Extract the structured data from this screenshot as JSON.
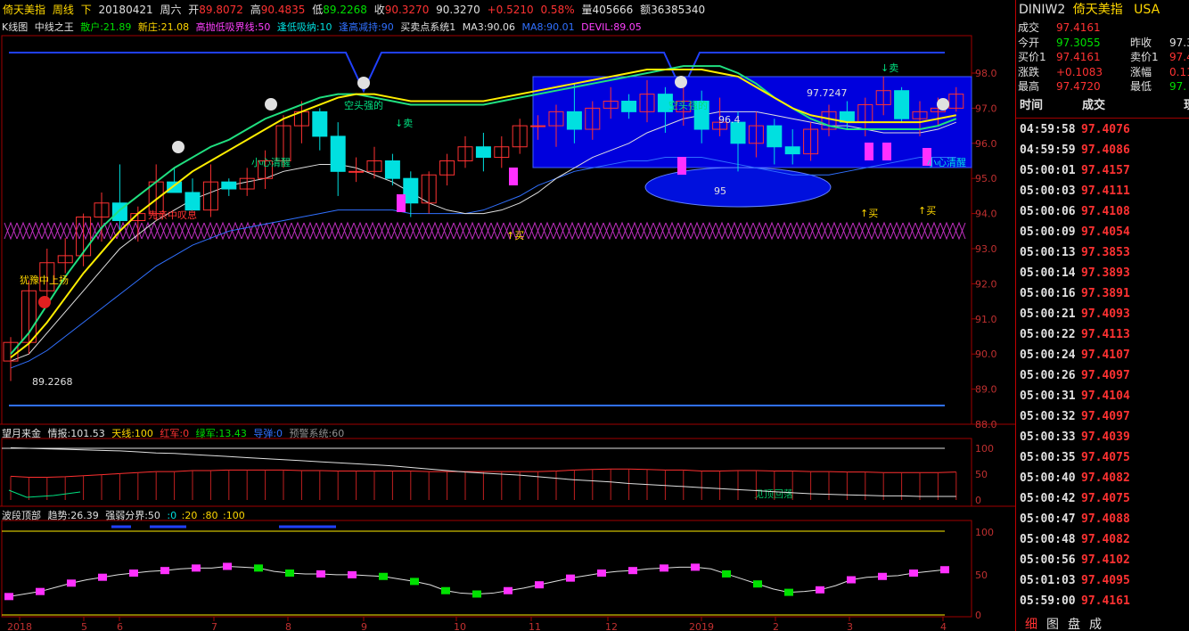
{
  "topbar": {
    "name": "倚天美指",
    "period": "周线",
    "direction": "下",
    "date": "20180421",
    "weekday": "周六",
    "open_label": "开",
    "open": "89.8072",
    "high_label": "高",
    "high": "90.4835",
    "low_label": "低",
    "low": "89.2268",
    "close_label": "收",
    "close": "90.3270",
    "close2": "90.3270",
    "change": "+0.5210",
    "change_pct": "0.58%",
    "volume_label": "量",
    "volume": "405666",
    "amount_label": "额",
    "amount": "36385340"
  },
  "main_legend": {
    "chart_kind": "K线图",
    "indicator": "中线之王",
    "sanhu": "散户:21.89",
    "xinzhuang": "新庄:21.08",
    "gaopao": "高抛低吸界线:50",
    "fengdi": "逢低吸纳:10",
    "fenggao": "逢高减持:90",
    "maimai": "买卖点系统1",
    "ma3": "MA3:90.06",
    "ma8": "MA8:90.01",
    "devil": "DEVIL:89.05"
  },
  "sub1_legend": {
    "name": "望月来金",
    "qingbao": "情报:101.53",
    "tianxian": "天线:100",
    "hongjun": "红军:0",
    "lvjun": "绿军:13.43",
    "dijiang": "导弹:0",
    "yujing": "预警系统:60"
  },
  "sub2_legend": {
    "name": "波段顶部",
    "qushi": "趋势:26.39",
    "qiangruo": "强弱分界:50",
    "l0": ":0",
    "l20": ":20",
    "l80": ":80",
    "l100": ":100"
  },
  "main_axis": [
    "98.0",
    "97.0",
    "96.0",
    "95.0",
    "94.0",
    "93.0",
    "92.0",
    "91.0",
    "90.0",
    "89.0",
    "88.0"
  ],
  "sub1_axis": [
    "100",
    "50",
    "0"
  ],
  "sub2_axis": [
    "100",
    "50",
    "0"
  ],
  "x_axis": [
    "2018",
    "5",
    "6",
    "7",
    "8",
    "9",
    "10",
    "11",
    "12",
    "2019",
    "2",
    "3",
    "4"
  ],
  "annotations": {
    "start_price": "89.2268",
    "price_97": "97.7247",
    "price_964": "96.4",
    "price_95": "95",
    "youyu": "犹豫中上扬",
    "xiaoxin1": "小心清醒",
    "xiaoxin2": "小心清醒",
    "kongtou1": "空头强的",
    "kongtou2": "空头强的",
    "xianxian": "先亲中叹息",
    "jiandui": "见顶回落",
    "sell1": "↓卖",
    "sell2": "↓卖",
    "buy1": "↑买",
    "buy2": "↑买",
    "buy3": "↑买"
  },
  "sidebar": {
    "symbol": "DINIW2",
    "name": "倚天美指",
    "market": "USA",
    "quote": [
      {
        "l1": "成交",
        "v1": "97.4161",
        "c1": "red",
        "l2": "",
        "v2": "",
        "c2": ""
      },
      {
        "l1": "今开",
        "v1": "97.3055",
        "c1": "grn",
        "l2": "昨收",
        "v2": "97.3",
        "c2": "wht"
      },
      {
        "l1": "买价1",
        "v1": "97.4161",
        "c1": "red",
        "l2": "卖价1",
        "v2": "97.4",
        "c2": "red"
      },
      {
        "l1": "涨跌",
        "v1": "+0.1083",
        "c1": "red",
        "l2": "涨幅",
        "v2": "0.11",
        "c2": "red"
      },
      {
        "l1": "最高",
        "v1": "97.4720",
        "c1": "red",
        "l2": "最低",
        "v2": "97.",
        "c2": "grn"
      }
    ],
    "ticks_header": {
      "time": "时间",
      "price": "成交",
      "extra": "现"
    },
    "ticks": [
      {
        "time": "04:59:58",
        "price": "97.4076"
      },
      {
        "time": "04:59:59",
        "price": "97.4086"
      },
      {
        "time": "05:00:01",
        "price": "97.4157"
      },
      {
        "time": "05:00:03",
        "price": "97.4111"
      },
      {
        "time": "05:00:06",
        "price": "97.4108"
      },
      {
        "time": "05:00:09",
        "price": "97.4054"
      },
      {
        "time": "05:00:13",
        "price": "97.3853"
      },
      {
        "time": "05:00:14",
        "price": "97.3893"
      },
      {
        "time": "05:00:16",
        "price": "97.3891"
      },
      {
        "time": "05:00:21",
        "price": "97.4093"
      },
      {
        "time": "05:00:22",
        "price": "97.4113"
      },
      {
        "time": "05:00:24",
        "price": "97.4107"
      },
      {
        "time": "05:00:26",
        "price": "97.4097"
      },
      {
        "time": "05:00:31",
        "price": "97.4104"
      },
      {
        "time": "05:00:32",
        "price": "97.4097"
      },
      {
        "time": "05:00:33",
        "price": "97.4039"
      },
      {
        "time": "05:00:35",
        "price": "97.4075"
      },
      {
        "time": "05:00:40",
        "price": "97.4082"
      },
      {
        "time": "05:00:42",
        "price": "97.4075"
      },
      {
        "time": "05:00:47",
        "price": "97.4088"
      },
      {
        "time": "05:00:48",
        "price": "97.4082"
      },
      {
        "time": "05:00:56",
        "price": "97.4102"
      },
      {
        "time": "05:01:03",
        "price": "97.4095"
      },
      {
        "time": "05:59:00",
        "price": "97.4161"
      }
    ],
    "tabs": [
      "细",
      "图",
      "盘",
      "成"
    ]
  },
  "colors": {
    "up": "#ff3232",
    "down": "#00e0e0",
    "grid": "#800000",
    "accent": "#ffd700"
  },
  "chart_data": {
    "type": "candlestick",
    "candles": [
      {
        "o": 89.8,
        "h": 90.48,
        "l": 89.23,
        "c": 90.33
      },
      {
        "o": 90.33,
        "h": 92.1,
        "l": 90.0,
        "c": 91.8
      },
      {
        "o": 91.8,
        "h": 93.0,
        "l": 91.4,
        "c": 92.6
      },
      {
        "o": 92.6,
        "h": 93.3,
        "l": 92.3,
        "c": 92.8
      },
      {
        "o": 92.8,
        "h": 94.0,
        "l": 92.5,
        "c": 93.9
      },
      {
        "o": 93.9,
        "h": 94.6,
        "l": 93.2,
        "c": 94.3
      },
      {
        "o": 94.3,
        "h": 95.4,
        "l": 93.5,
        "c": 93.8
      },
      {
        "o": 93.8,
        "h": 94.2,
        "l": 93.2,
        "c": 94.0
      },
      {
        "o": 94.0,
        "h": 95.4,
        "l": 93.8,
        "c": 94.9
      },
      {
        "o": 94.9,
        "h": 95.3,
        "l": 94.6,
        "c": 94.6
      },
      {
        "o": 94.6,
        "h": 95.0,
        "l": 94.1,
        "c": 94.1
      },
      {
        "o": 94.1,
        "h": 95.4,
        "l": 93.9,
        "c": 94.9
      },
      {
        "o": 94.9,
        "h": 95.0,
        "l": 94.5,
        "c": 94.7
      },
      {
        "o": 94.7,
        "h": 95.3,
        "l": 94.5,
        "c": 95.0
      },
      {
        "o": 95.0,
        "h": 95.8,
        "l": 94.7,
        "c": 95.5
      },
      {
        "o": 95.5,
        "h": 96.8,
        "l": 95.3,
        "c": 96.5
      },
      {
        "o": 96.5,
        "h": 97.2,
        "l": 96.0,
        "c": 96.9
      },
      {
        "o": 96.9,
        "h": 97.0,
        "l": 95.8,
        "c": 96.2
      },
      {
        "o": 96.2,
        "h": 96.6,
        "l": 94.5,
        "c": 95.2
      },
      {
        "o": 95.2,
        "h": 95.6,
        "l": 94.9,
        "c": 95.2
      },
      {
        "o": 95.2,
        "h": 95.9,
        "l": 95.0,
        "c": 95.5
      },
      {
        "o": 95.5,
        "h": 95.7,
        "l": 94.8,
        "c": 95.0
      },
      {
        "o": 95.0,
        "h": 95.2,
        "l": 93.9,
        "c": 94.3
      },
      {
        "o": 94.3,
        "h": 95.2,
        "l": 94.0,
        "c": 95.1
      },
      {
        "o": 95.1,
        "h": 95.7,
        "l": 94.8,
        "c": 95.5
      },
      {
        "o": 95.5,
        "h": 96.2,
        "l": 95.3,
        "c": 95.9
      },
      {
        "o": 95.9,
        "h": 96.3,
        "l": 95.2,
        "c": 95.6
      },
      {
        "o": 95.6,
        "h": 96.2,
        "l": 95.3,
        "c": 95.9
      },
      {
        "o": 95.9,
        "h": 96.7,
        "l": 95.7,
        "c": 96.5
      },
      {
        "o": 96.5,
        "h": 96.8,
        "l": 96.1,
        "c": 96.5
      },
      {
        "o": 96.5,
        "h": 97.1,
        "l": 95.9,
        "c": 96.9
      },
      {
        "o": 96.9,
        "h": 97.7,
        "l": 96.0,
        "c": 96.4
      },
      {
        "o": 96.4,
        "h": 97.2,
        "l": 96.1,
        "c": 97.0
      },
      {
        "o": 97.0,
        "h": 97.6,
        "l": 96.7,
        "c": 97.2
      },
      {
        "o": 97.2,
        "h": 97.4,
        "l": 96.7,
        "c": 96.9
      },
      {
        "o": 96.9,
        "h": 97.8,
        "l": 96.6,
        "c": 97.4
      },
      {
        "o": 97.4,
        "h": 97.6,
        "l": 96.3,
        "c": 96.9
      },
      {
        "o": 96.9,
        "h": 97.8,
        "l": 96.5,
        "c": 97.2
      },
      {
        "o": 97.2,
        "h": 97.5,
        "l": 96.0,
        "c": 96.4
      },
      {
        "o": 96.4,
        "h": 97.3,
        "l": 96.2,
        "c": 96.6
      },
      {
        "o": 96.6,
        "h": 96.9,
        "l": 95.2,
        "c": 96.0
      },
      {
        "o": 96.0,
        "h": 96.9,
        "l": 95.6,
        "c": 96.5
      },
      {
        "o": 96.5,
        "h": 96.7,
        "l": 95.4,
        "c": 95.9
      },
      {
        "o": 95.9,
        "h": 96.4,
        "l": 95.4,
        "c": 95.7
      },
      {
        "o": 95.7,
        "h": 96.6,
        "l": 95.5,
        "c": 96.4
      },
      {
        "o": 96.4,
        "h": 97.1,
        "l": 96.2,
        "c": 96.9
      },
      {
        "o": 96.9,
        "h": 97.2,
        "l": 96.4,
        "c": 96.6
      },
      {
        "o": 96.6,
        "h": 97.3,
        "l": 96.2,
        "c": 97.1
      },
      {
        "o": 97.1,
        "h": 97.9,
        "l": 96.8,
        "c": 97.5
      },
      {
        "o": 97.5,
        "h": 97.6,
        "l": 96.6,
        "c": 96.7
      },
      {
        "o": 96.7,
        "h": 97.2,
        "l": 96.2,
        "c": 96.9
      },
      {
        "o": 96.9,
        "h": 97.3,
        "l": 96.5,
        "c": 97.0
      },
      {
        "o": 97.0,
        "h": 97.6,
        "l": 96.9,
        "c": 97.4
      }
    ],
    "ma_green": [
      90.0,
      90.6,
      91.4,
      92.2,
      92.9,
      93.6,
      94.1,
      94.5,
      94.9,
      95.3,
      95.6,
      95.9,
      96.1,
      96.4,
      96.7,
      96.9,
      97.1,
      97.3,
      97.4,
      97.4,
      97.3,
      97.2,
      97.1,
      97.1,
      97.1,
      97.1,
      97.1,
      97.2,
      97.3,
      97.4,
      97.5,
      97.6,
      97.7,
      97.8,
      97.9,
      98.0,
      98.1,
      98.2,
      98.2,
      98.2,
      98.0,
      97.7,
      97.3,
      97.0,
      96.7,
      96.5,
      96.4,
      96.4,
      96.4,
      96.4,
      96.4,
      96.5,
      96.7
    ],
    "ma_yellow": [
      89.9,
      90.3,
      90.9,
      91.6,
      92.3,
      92.9,
      93.5,
      94.0,
      94.4,
      94.8,
      95.2,
      95.5,
      95.8,
      96.1,
      96.4,
      96.7,
      96.9,
      97.1,
      97.3,
      97.4,
      97.4,
      97.3,
      97.2,
      97.2,
      97.2,
      97.2,
      97.2,
      97.3,
      97.4,
      97.5,
      97.6,
      97.7,
      97.8,
      97.9,
      98.0,
      98.1,
      98.1,
      98.1,
      98.1,
      98.0,
      97.9,
      97.6,
      97.3,
      97.0,
      96.8,
      96.7,
      96.6,
      96.6,
      96.6,
      96.6,
      96.6,
      96.7,
      96.8
    ],
    "ma_white": [
      89.8,
      90.0,
      90.6,
      91.2,
      91.8,
      92.4,
      93.0,
      93.4,
      93.8,
      94.1,
      94.4,
      94.6,
      94.8,
      94.9,
      95.0,
      95.2,
      95.3,
      95.4,
      95.4,
      95.3,
      95.1,
      94.9,
      94.6,
      94.3,
      94.1,
      94.0,
      94.0,
      94.1,
      94.3,
      94.6,
      95.0,
      95.3,
      95.6,
      95.8,
      96.0,
      96.3,
      96.5,
      96.7,
      96.8,
      96.9,
      96.9,
      96.9,
      96.8,
      96.7,
      96.6,
      96.5,
      96.5,
      96.4,
      96.3,
      96.3,
      96.3,
      96.4,
      96.6
    ],
    "ma_blue": [
      89.6,
      89.8,
      90.1,
      90.5,
      90.9,
      91.3,
      91.7,
      92.1,
      92.5,
      92.8,
      93.1,
      93.3,
      93.5,
      93.6,
      93.7,
      93.8,
      93.9,
      94.0,
      94.1,
      94.1,
      94.1,
      94.1,
      94.0,
      94.0,
      94.0,
      94.0,
      94.1,
      94.3,
      94.5,
      94.8,
      95.0,
      95.2,
      95.3,
      95.4,
      95.5,
      95.5,
      95.6,
      95.6,
      95.6,
      95.5,
      95.4,
      95.3,
      95.2,
      95.1,
      95.1,
      95.1,
      95.2,
      95.3,
      95.4,
      95.5,
      95.6,
      95.6,
      95.6
    ],
    "sub1_red": [
      46,
      44,
      44,
      45,
      47,
      49,
      51,
      53,
      55,
      55,
      57,
      57,
      58,
      58,
      58,
      58,
      57,
      57,
      56,
      56,
      56,
      56,
      56,
      55,
      55,
      55,
      55,
      55,
      55,
      55,
      56,
      58,
      59,
      60,
      60,
      59,
      58,
      58,
      56,
      56,
      57,
      57,
      56,
      56,
      55,
      55,
      54,
      54,
      53,
      53,
      53,
      53,
      54
    ],
    "sub1_white": [
      101,
      100,
      99,
      98,
      97,
      96,
      95,
      93,
      91,
      90,
      88,
      86,
      84,
      82,
      80,
      78,
      76,
      74,
      72,
      70,
      68,
      66,
      63,
      60,
      57,
      54,
      52,
      50,
      48,
      45,
      42,
      39,
      37,
      35,
      32,
      30,
      28,
      26,
      24,
      22,
      20,
      18,
      16,
      14,
      12,
      11,
      10,
      9,
      8,
      8,
      7,
      7,
      7
    ],
    "sub2_values": [
      22,
      25,
      28,
      33,
      38,
      42,
      45,
      48,
      50,
      52,
      53,
      55,
      56,
      56,
      58,
      57,
      56,
      52,
      50,
      49,
      49,
      48,
      48,
      47,
      46,
      43,
      40,
      36,
      29,
      26,
      25,
      26,
      29,
      32,
      36,
      40,
      44,
      47,
      50,
      52,
      53,
      55,
      56,
      57,
      57,
      55,
      49,
      43,
      37,
      31,
      27,
      28,
      30,
      35,
      42,
      45,
      46,
      47,
      50,
      52,
      54
    ]
  }
}
